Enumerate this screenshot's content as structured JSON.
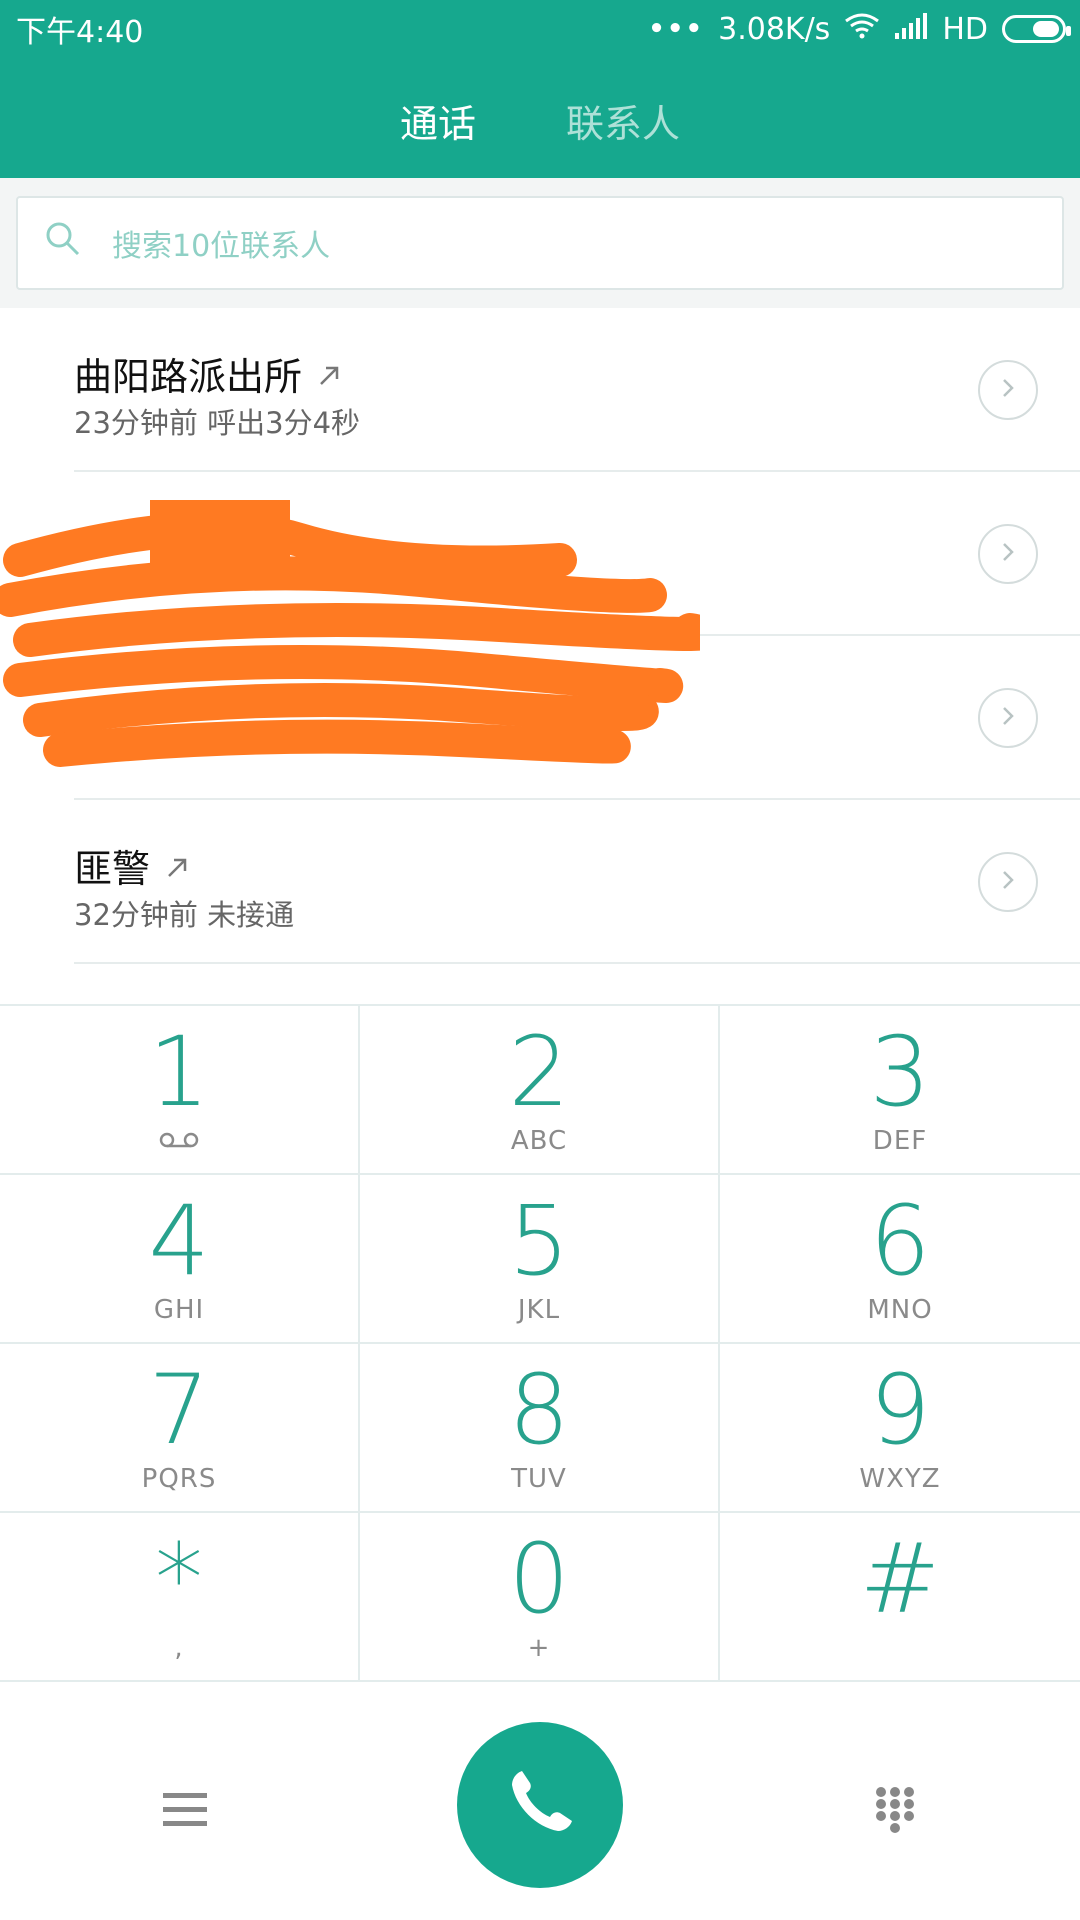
{
  "status_bar": {
    "time": "下午4:40",
    "dots": "•••",
    "network_speed": "3.08K/s",
    "hd": "HD",
    "icons": [
      "wifi-icon",
      "signal-icon",
      "battery-icon"
    ]
  },
  "tabs": [
    {
      "label": "通话",
      "active": true
    },
    {
      "label": "联系人",
      "active": false
    }
  ],
  "search": {
    "placeholder": "搜索10位联系人"
  },
  "calls": [
    {
      "name": "曲阳路派出所",
      "detail": "23分钟前 呼出3分4秒",
      "direction_icon": "outgoing-arrow-icon"
    },
    {
      "name": "",
      "detail": "",
      "direction_icon": ""
    },
    {
      "name": "",
      "detail": "",
      "direction_icon": ""
    },
    {
      "name": "匪警",
      "detail": "32分钟前 未接通",
      "direction_icon": "outgoing-arrow-icon"
    }
  ],
  "keypad": [
    {
      "digit": "1",
      "letters": ""
    },
    {
      "digit": "2",
      "letters": "ABC"
    },
    {
      "digit": "3",
      "letters": "DEF"
    },
    {
      "digit": "4",
      "letters": "GHI"
    },
    {
      "digit": "5",
      "letters": "JKL"
    },
    {
      "digit": "6",
      "letters": "MNO"
    },
    {
      "digit": "7",
      "letters": "PQRS"
    },
    {
      "digit": "8",
      "letters": "TUV"
    },
    {
      "digit": "9",
      "letters": "WXYZ"
    },
    {
      "digit": "*",
      "letters": ","
    },
    {
      "digit": "0",
      "letters": "+"
    },
    {
      "digit": "#",
      "letters": ""
    }
  ],
  "colors": {
    "primary": "#16a88e",
    "redaction": "#ff7a22"
  }
}
